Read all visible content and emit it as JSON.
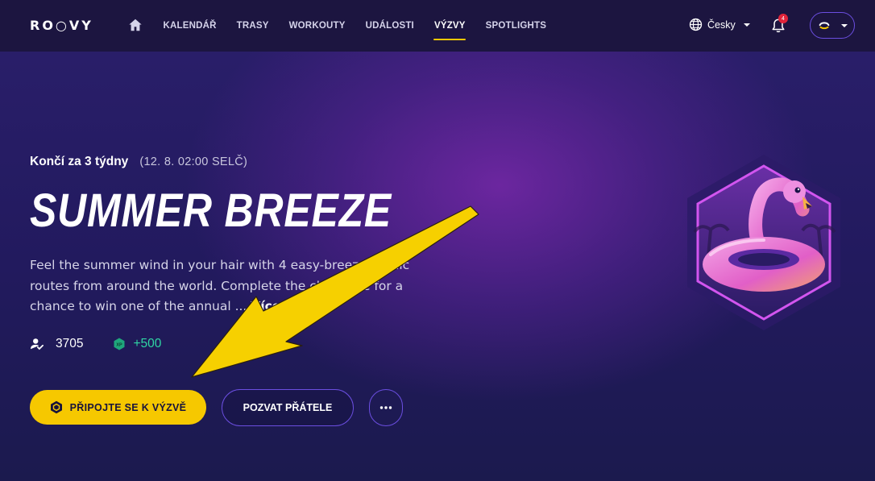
{
  "app": {
    "logo_text": "RO○VY"
  },
  "nav": {
    "items": [
      {
        "label": "KALENDÁŘ"
      },
      {
        "label": "TRASY"
      },
      {
        "label": "WORKOUTY"
      },
      {
        "label": "UDÁLOSTI"
      },
      {
        "label": "VÝZVY",
        "active": true
      },
      {
        "label": "SPOTLIGHTS"
      }
    ],
    "language": "Česky",
    "notifications_count": "4"
  },
  "challenge": {
    "ends_in": "Končí za 3 týdny",
    "ends_date": "(12. 8. 02:00 SELČ)",
    "title": "SUMMER BREEZE",
    "description": "Feel the summer wind in your hair with 4 easy-breezy scenic routes from around the world. Complete the challenge for a chance to win one of the annual ...",
    "more_label": "Více",
    "participants": "3705",
    "xp_reward": "+500",
    "xp_icon_label": "XP"
  },
  "actions": {
    "join_label": "PŘIPOJTE SE K VÝZVĚ",
    "invite_label": "POZVAT PŘÁTELE"
  },
  "colors": {
    "accent": "#f6c800",
    "nav_bg": "#1c1540",
    "outline": "#6b4ee0",
    "xp_green": "#2fd6a4"
  },
  "icons": [
    "home-icon",
    "globe-icon",
    "bell-icon",
    "user-avatar-icon",
    "participants-icon",
    "xp-icon",
    "hexagon-icon",
    "more-dots-icon"
  ]
}
